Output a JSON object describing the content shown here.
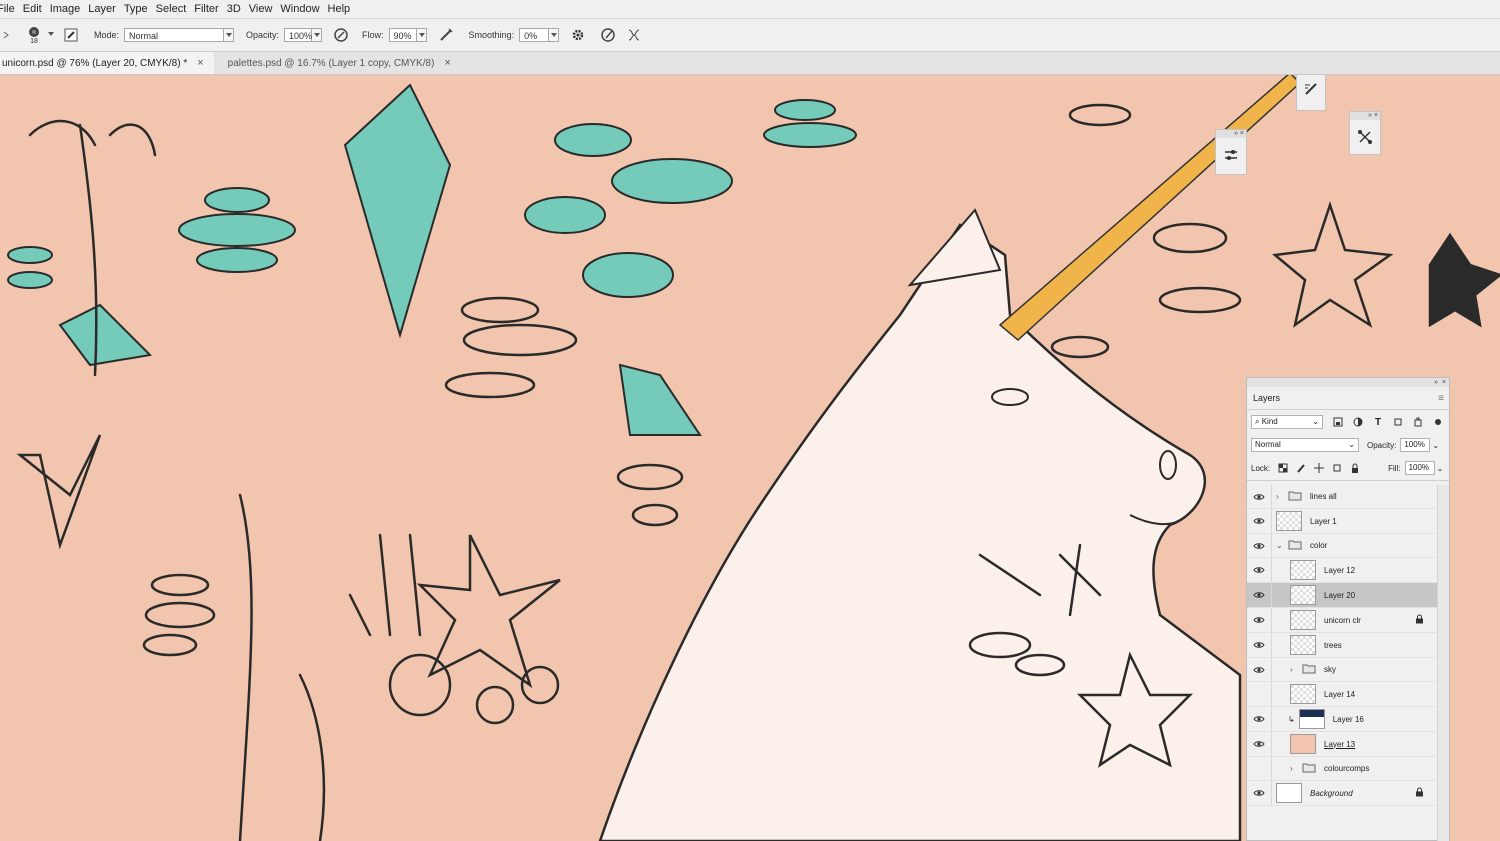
{
  "menubar": {
    "items": [
      "File",
      "Edit",
      "Image",
      "Layer",
      "Type",
      "Select",
      "Filter",
      "3D",
      "View",
      "Window",
      "Help"
    ]
  },
  "options_bar": {
    "brush_size": "18",
    "mode_label": "Mode:",
    "mode_value": "Normal",
    "opacity_label": "Opacity:",
    "opacity_value": "100%",
    "flow_label": "Flow:",
    "flow_value": "90%",
    "smoothing_label": "Smoothing:",
    "smoothing_value": "0%"
  },
  "tabs": [
    {
      "label": "unicorn.psd @ 76% (Layer 20, CMYK/8) *",
      "close": "×"
    },
    {
      "label": "palettes.psd @ 16.7% (Layer 1 copy, CMYK/8)",
      "close": "×"
    }
  ],
  "colors": {
    "canvas_bg": "#f2c6ae",
    "teal": "#74cbb9",
    "horn": "#f0b44a",
    "panel": "#f0f0f0",
    "selected_row": "#c6c6c6"
  },
  "layers_panel": {
    "title": "Layers",
    "filter_label": "Kind",
    "blend_mode": "Normal",
    "opacity_label": "Opacity:",
    "opacity_value": "100%",
    "lock_label": "Lock:",
    "fill_label": "Fill:",
    "fill_value": "100%",
    "layers": [
      {
        "name": "lines all",
        "type": "group",
        "visible": true,
        "expanded": false,
        "indent": 0
      },
      {
        "name": "Layer 1",
        "type": "layer",
        "visible": true,
        "indent": 0
      },
      {
        "name": "color",
        "type": "group",
        "visible": true,
        "expanded": true,
        "indent": 0
      },
      {
        "name": "Layer 12",
        "type": "layer",
        "visible": true,
        "indent": 1
      },
      {
        "name": "Layer 20",
        "type": "layer",
        "visible": true,
        "indent": 1,
        "selected": true
      },
      {
        "name": "unicorn clr",
        "type": "layer",
        "visible": true,
        "indent": 1,
        "locked": true
      },
      {
        "name": "trees",
        "type": "layer",
        "visible": true,
        "indent": 1
      },
      {
        "name": "sky",
        "type": "group",
        "visible": true,
        "expanded": false,
        "indent": 1
      },
      {
        "name": "Layer 14",
        "type": "layer",
        "visible": false,
        "indent": 1
      },
      {
        "name": "Layer 16",
        "type": "layer",
        "visible": true,
        "indent": 1,
        "clipped": true
      },
      {
        "name": "Layer 13",
        "type": "layer",
        "visible": true,
        "indent": 1,
        "underlined": true
      },
      {
        "name": "colourcomps",
        "type": "group",
        "visible": false,
        "expanded": false,
        "indent": 1
      },
      {
        "name": "Background",
        "type": "layer",
        "visible": true,
        "indent": 0,
        "locked": true,
        "italic": true
      }
    ]
  }
}
